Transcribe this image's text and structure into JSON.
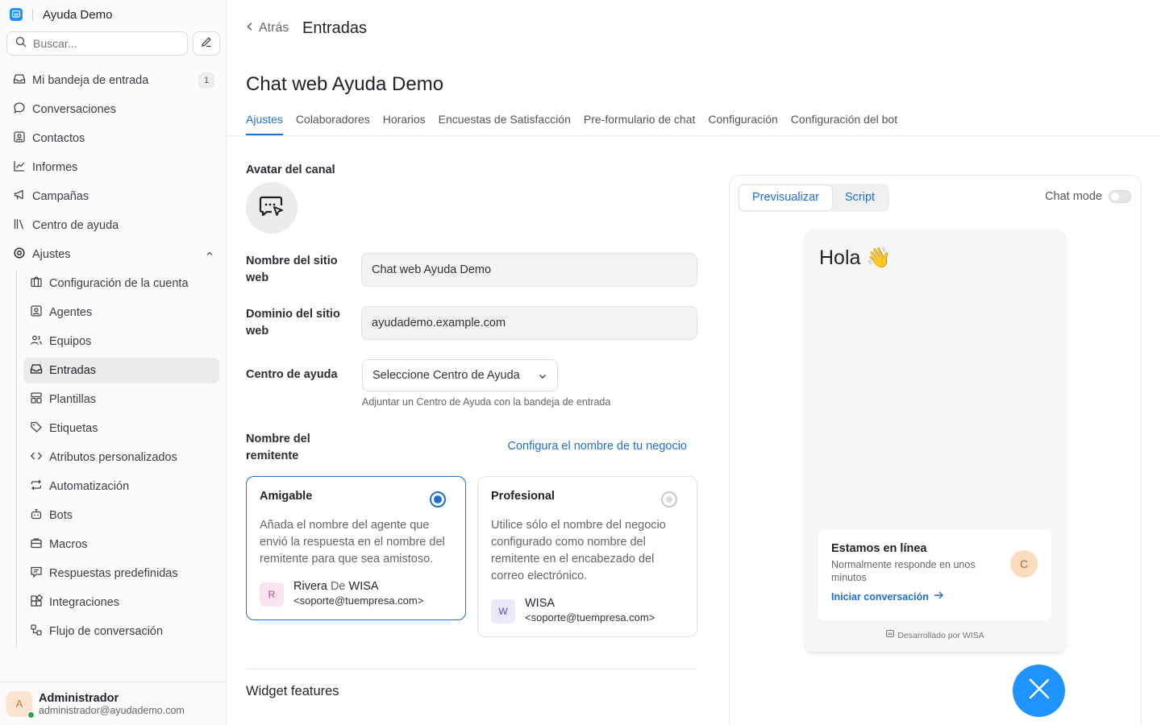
{
  "app": {
    "name": "Ayuda Demo",
    "brand_color": "#1f93ff"
  },
  "search": {
    "placeholder": "Buscar..."
  },
  "nav": {
    "inbox": {
      "label": "Mi bandeja de entrada",
      "count": "1"
    },
    "conversations": "Conversaciones",
    "contacts": "Contactos",
    "reports": "Informes",
    "campaigns": "Campañas",
    "help_center": "Centro de ayuda",
    "settings": "Ajustes"
  },
  "settings_nav": [
    {
      "label": "Configuración de la cuenta",
      "icon": "building-icon"
    },
    {
      "label": "Agentes",
      "icon": "person-square-icon"
    },
    {
      "label": "Equipos",
      "icon": "people-icon"
    },
    {
      "label": "Entradas",
      "icon": "inbox-icon",
      "active": true
    },
    {
      "label": "Plantillas",
      "icon": "template-icon"
    },
    {
      "label": "Etiquetas",
      "icon": "tag-icon"
    },
    {
      "label": "Atributos personalizados",
      "icon": "code-icon"
    },
    {
      "label": "Automatización",
      "icon": "repeat-icon"
    },
    {
      "label": "Bots",
      "icon": "bot-icon"
    },
    {
      "label": "Macros",
      "icon": "briefcase-icon"
    },
    {
      "label": "Respuestas predefinidas",
      "icon": "canned-response-icon"
    },
    {
      "label": "Integraciones",
      "icon": "integration-icon"
    },
    {
      "label": "Flujo de conversación",
      "icon": "flow-icon"
    }
  ],
  "profile": {
    "initial": "A",
    "name": "Administrador",
    "email": "administrador@ayudademo.com"
  },
  "header": {
    "back": "Atrás",
    "breadcrumb": "Entradas",
    "page_title": "Chat web Ayuda Demo"
  },
  "tabs": [
    "Ajustes",
    "Colaboradores",
    "Horarios",
    "Encuestas de Satisfacción",
    "Pre-formulario de chat",
    "Configuración",
    "Configuración del bot"
  ],
  "form": {
    "channel_avatar_label": "Avatar del canal",
    "site_name_label": "Nombre del sitio web",
    "site_name_value": "Chat web Ayuda Demo",
    "site_domain_label": "Dominio del sitio web",
    "site_domain_value": "ayudademo.example.com",
    "help_center_label": "Centro de ayuda",
    "help_center_select": "Seleccione Centro de Ayuda",
    "help_center_hint": "Adjuntar un Centro de Ayuda con la bandeja de entrada",
    "sender_name_label": "Nombre del remitente",
    "sender_name_link": "Configura el nombre de tu negocio"
  },
  "sender_options": {
    "friendly": {
      "title": "Amigable",
      "description": "Añada el nombre del agente que envió la respuesta en el nombre del remitente para que sea amistoso.",
      "avatar": "R",
      "agent": "Rivera",
      "connector": "De",
      "business": "WISA",
      "email": "<soporte@tuempresa.com>",
      "selected": true
    },
    "professional": {
      "title": "Profesional",
      "description": "Utilice sólo el nombre del negocio configurado como nombre del remitente en el encabezado del correo electrónico.",
      "avatar": "W",
      "business": "WISA",
      "email": "<soporte@tuempresa.com>",
      "selected": false
    }
  },
  "widget_features_title": "Widget features",
  "preview": {
    "tab_preview": "Previsualizar",
    "tab_script": "Script",
    "chat_mode_label": "Chat mode",
    "chat_mode_on": false,
    "greeting": "Hola 👋",
    "online_title": "Estamos en línea",
    "online_subtitle": "Normalmente responde en unos minutos",
    "start_conversation": "Iniciar conversación",
    "agent_initial": "C",
    "powered_by": "Desarrollado por WISA"
  }
}
